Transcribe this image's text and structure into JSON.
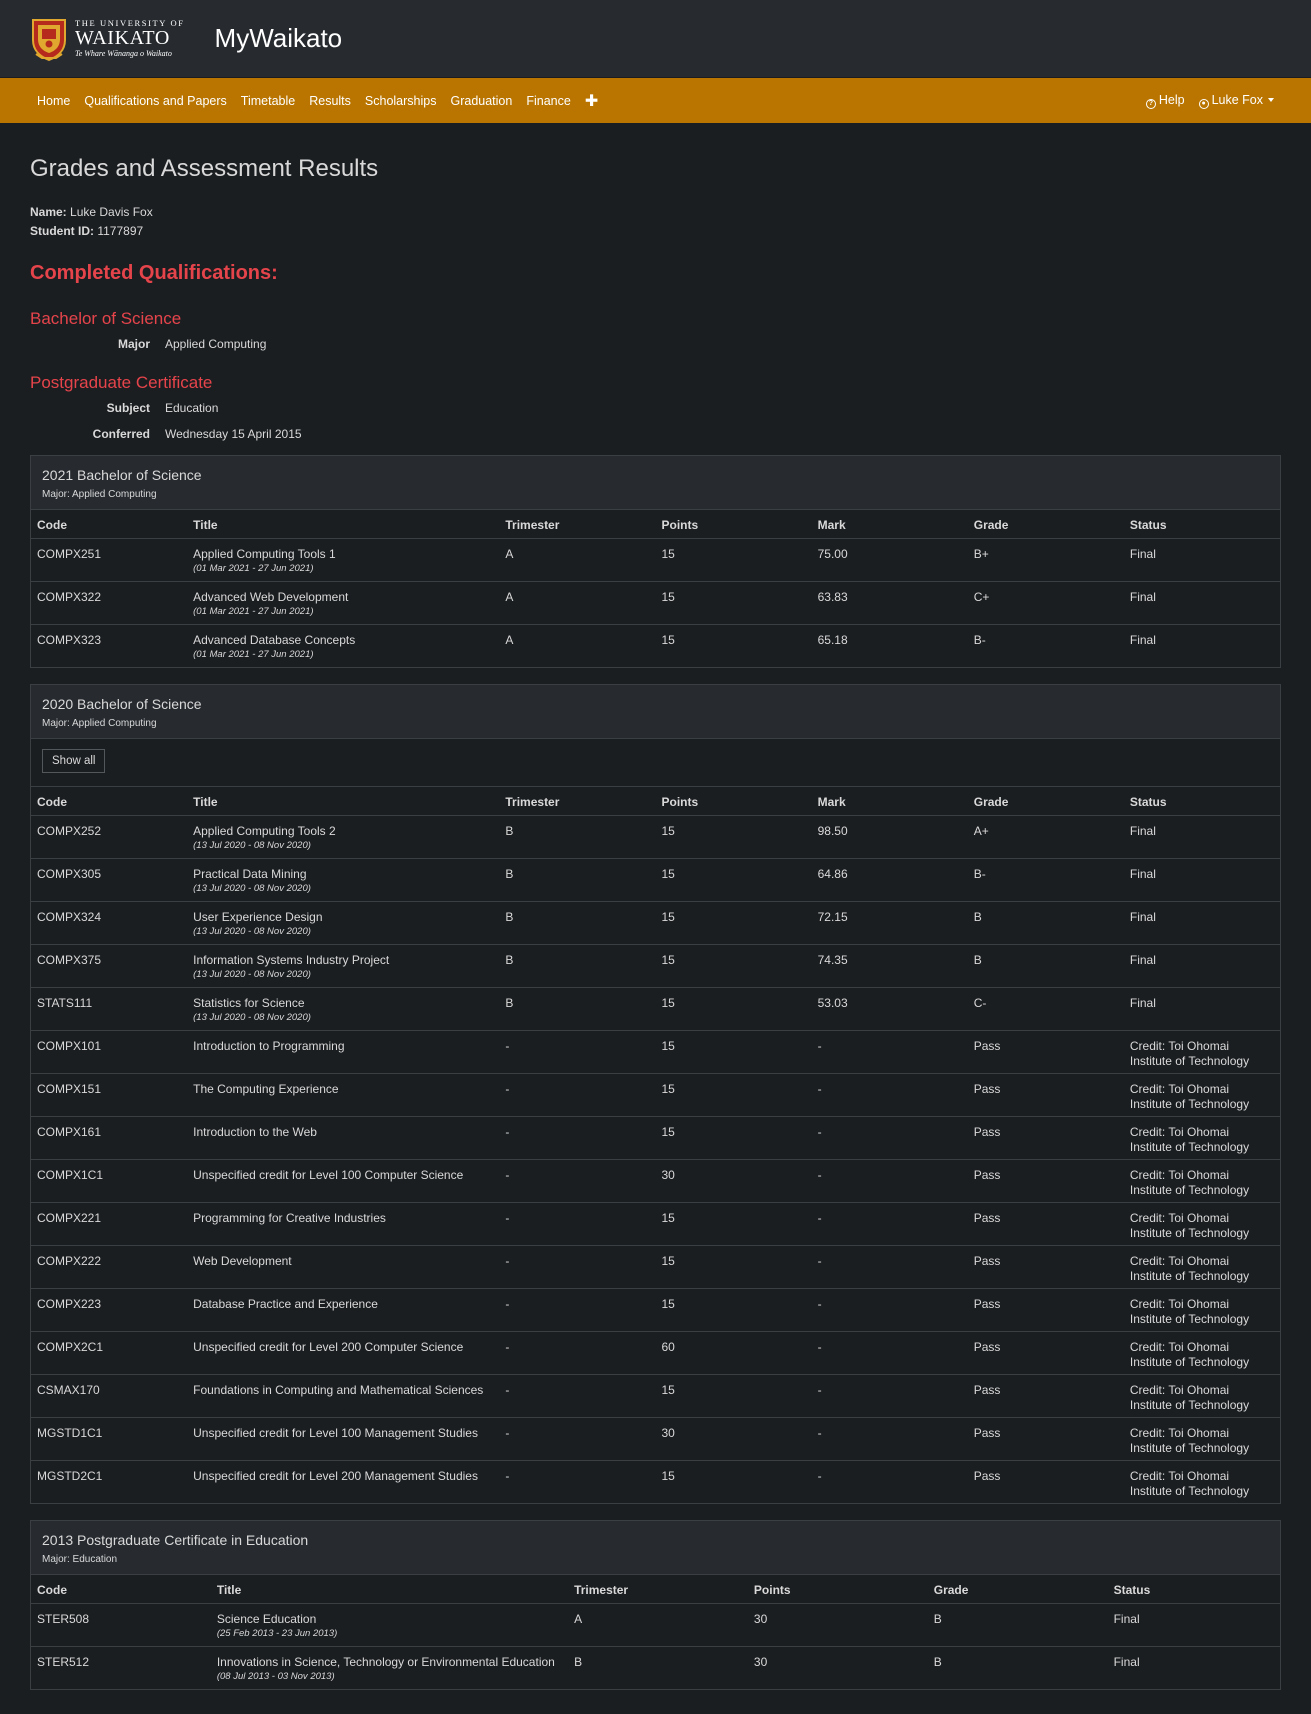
{
  "header": {
    "logo": {
      "line1": "THE UNIVERSITY OF",
      "line2": "WAIKATO",
      "line3": "Te Whare Wānanga o Waikato"
    },
    "app_title": "MyWaikato"
  },
  "nav": {
    "items": [
      "Home",
      "Qualifications and Papers",
      "Timetable",
      "Results",
      "Scholarships",
      "Graduation",
      "Finance"
    ],
    "more_icon": "plus-icon",
    "help_label": "Help",
    "user_label": "Luke Fox"
  },
  "page": {
    "title": "Grades and Assessment Results",
    "name_label": "Name:",
    "name_value": "Luke Davis Fox",
    "student_id_label": "Student ID:",
    "student_id_value": "1177897",
    "completed_heading": "Completed Qualifications:"
  },
  "qualifications": [
    {
      "name": "Bachelor of Science",
      "rows": [
        {
          "label": "Major",
          "value": "Applied Computing"
        }
      ]
    },
    {
      "name": "Postgraduate Certificate",
      "rows": [
        {
          "label": "Subject",
          "value": "Education"
        },
        {
          "label": "Conferred",
          "value": "Wednesday 15 April 2015"
        }
      ]
    }
  ],
  "cards": [
    {
      "title": "2021 Bachelor of Science",
      "subtitle": "Major: Applied Computing",
      "headers": [
        "Code",
        "Title",
        "Trimester",
        "Points",
        "Mark",
        "Grade",
        "Status"
      ],
      "rows": [
        {
          "code": "COMPX251",
          "title": "Applied Computing Tools 1",
          "date": "(01 Mar 2021 - 27 Jun 2021)",
          "trimester": "A",
          "points": "15",
          "mark": "75.00",
          "grade": "B+",
          "status": "Final"
        },
        {
          "code": "COMPX322",
          "title": "Advanced Web Development",
          "date": "(01 Mar 2021 - 27 Jun 2021)",
          "trimester": "A",
          "points": "15",
          "mark": "63.83",
          "grade": "C+",
          "status": "Final"
        },
        {
          "code": "COMPX323",
          "title": "Advanced Database Concepts",
          "date": "(01 Mar 2021 - 27 Jun 2021)",
          "trimester": "A",
          "points": "15",
          "mark": "65.18",
          "grade": "B-",
          "status": "Final"
        }
      ]
    },
    {
      "title": "2020 Bachelor of Science",
      "subtitle": "Major: Applied Computing",
      "show_all_label": "Show all",
      "headers": [
        "Code",
        "Title",
        "Trimester",
        "Points",
        "Mark",
        "Grade",
        "Status"
      ],
      "rows": [
        {
          "code": "COMPX252",
          "title": "Applied Computing Tools 2",
          "date": "(13 Jul 2020 - 08 Nov 2020)",
          "trimester": "B",
          "points": "15",
          "mark": "98.50",
          "grade": "A+",
          "status": "Final"
        },
        {
          "code": "COMPX305",
          "title": "Practical Data Mining",
          "date": "(13 Jul 2020 - 08 Nov 2020)",
          "trimester": "B",
          "points": "15",
          "mark": "64.86",
          "grade": "B-",
          "status": "Final"
        },
        {
          "code": "COMPX324",
          "title": "User Experience Design",
          "date": "(13 Jul 2020 - 08 Nov 2020)",
          "trimester": "B",
          "points": "15",
          "mark": "72.15",
          "grade": "B",
          "status": "Final"
        },
        {
          "code": "COMPX375",
          "title": "Information Systems Industry Project",
          "date": "(13 Jul 2020 - 08 Nov 2020)",
          "trimester": "B",
          "points": "15",
          "mark": "74.35",
          "grade": "B",
          "status": "Final"
        },
        {
          "code": "STATS111",
          "title": "Statistics for Science",
          "date": "(13 Jul 2020 - 08 Nov 2020)",
          "trimester": "B",
          "points": "15",
          "mark": "53.03",
          "grade": "C-",
          "status": "Final"
        },
        {
          "code": "COMPX101",
          "title": "Introduction to Programming",
          "trimester": "-",
          "points": "15",
          "mark": "-",
          "grade": "Pass",
          "status": "Credit: Toi Ohomai Institute of Technology"
        },
        {
          "code": "COMPX151",
          "title": "The Computing Experience",
          "trimester": "-",
          "points": "15",
          "mark": "-",
          "grade": "Pass",
          "status": "Credit: Toi Ohomai Institute of Technology"
        },
        {
          "code": "COMPX161",
          "title": "Introduction to the Web",
          "trimester": "-",
          "points": "15",
          "mark": "-",
          "grade": "Pass",
          "status": "Credit: Toi Ohomai Institute of Technology"
        },
        {
          "code": "COMPX1C1",
          "title": "Unspecified credit for Level 100 Computer Science",
          "trimester": "-",
          "points": "30",
          "mark": "-",
          "grade": "Pass",
          "status": "Credit: Toi Ohomai Institute of Technology"
        },
        {
          "code": "COMPX221",
          "title": "Programming for Creative Industries",
          "trimester": "-",
          "points": "15",
          "mark": "-",
          "grade": "Pass",
          "status": "Credit: Toi Ohomai Institute of Technology"
        },
        {
          "code": "COMPX222",
          "title": "Web Development",
          "trimester": "-",
          "points": "15",
          "mark": "-",
          "grade": "Pass",
          "status": "Credit: Toi Ohomai Institute of Technology"
        },
        {
          "code": "COMPX223",
          "title": "Database Practice and Experience",
          "trimester": "-",
          "points": "15",
          "mark": "-",
          "grade": "Pass",
          "status": "Credit: Toi Ohomai Institute of Technology"
        },
        {
          "code": "COMPX2C1",
          "title": "Unspecified credit for Level 200 Computer Science",
          "trimester": "-",
          "points": "60",
          "mark": "-",
          "grade": "Pass",
          "status": "Credit: Toi Ohomai Institute of Technology"
        },
        {
          "code": "CSMAX170",
          "title": "Foundations in Computing and Mathematical Sciences",
          "trimester": "-",
          "points": "15",
          "mark": "-",
          "grade": "Pass",
          "status": "Credit: Toi Ohomai Institute of Technology"
        },
        {
          "code": "MGSTD1C1",
          "title": "Unspecified credit for Level 100 Management Studies",
          "trimester": "-",
          "points": "30",
          "mark": "-",
          "grade": "Pass",
          "status": "Credit: Toi Ohomai Institute of Technology"
        },
        {
          "code": "MGSTD2C1",
          "title": "Unspecified credit for Level 200 Management Studies",
          "trimester": "-",
          "points": "15",
          "mark": "-",
          "grade": "Pass",
          "status": "Credit: Toi Ohomai Institute of Technology"
        }
      ]
    },
    {
      "title": "2013 Postgraduate Certificate in Education",
      "subtitle": "Major: Education",
      "headers": [
        "Code",
        "Title",
        "Trimester",
        "Points",
        "Grade",
        "Status"
      ],
      "rows": [
        {
          "code": "STER508",
          "title": "Science Education",
          "date": "(25 Feb 2013 - 23 Jun 2013)",
          "trimester": "A",
          "points": "30",
          "grade": "B",
          "status": "Final"
        },
        {
          "code": "STER512",
          "title": "Innovations in Science, Technology or Environmental Education",
          "date": "(08 Jul 2013 - 03 Nov 2013)",
          "trimester": "B",
          "points": "30",
          "grade": "B",
          "status": "Final"
        }
      ]
    }
  ]
}
